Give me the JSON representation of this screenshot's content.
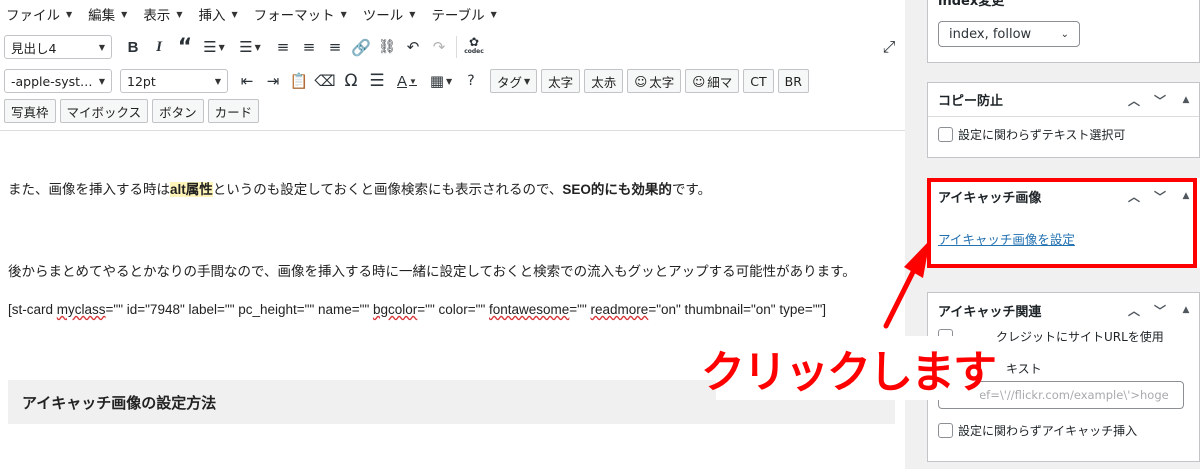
{
  "menubar": {
    "items": [
      "ファイル",
      "編集",
      "表示",
      "挿入",
      "フォーマット",
      "ツール",
      "テーブル"
    ]
  },
  "toolbar": {
    "format_select": "見出し4",
    "font_select": "-apple-syst…",
    "size_select": "12pt",
    "codec_label": "codec",
    "row2_buttons": [
      "タグ",
      "太字",
      "太赤",
      "太字",
      "細マ",
      "CT",
      "BR"
    ],
    "row3_buttons": [
      "写真枠",
      "マイボックス",
      "ボタン",
      "カード"
    ]
  },
  "content": {
    "p1_a": "また、画像を挿入する時は",
    "p1_b": "alt属性",
    "p1_c": "というのも設定しておくと画像検索にも表示されるので、",
    "p1_d": "SEO的にも効果的",
    "p1_e": "です。",
    "p2": "後からまとめてやるとかなりの手間なので、画像を挿入する時に一緒に設定しておくと検索での流入もグッとアップする可能性があります。",
    "sc_1": "[st-card ",
    "sc_2": "myclass",
    "sc_3": "=\"\" id=\"7948\" label=\"\" pc_height=\"\" name=\"\" ",
    "sc_4": "bgcolor",
    "sc_5": "=\"\" color=\"\" ",
    "sc_6": "fontawesome",
    "sc_7": "=\"\" ",
    "sc_8": "readmore",
    "sc_9": "=\"on\" thumbnail=\"on\" type=\"\"]",
    "heading": "アイキャッチ画像の設定方法"
  },
  "sidebar": {
    "index_title": "index変更",
    "index_select": "index, follow",
    "copy_title": "コピー防止",
    "copy_checkbox": "設定に関わらずテキスト選択可",
    "eyecatch_title": "アイキャッチ画像",
    "eyecatch_link": "アイキャッチ画像を設定",
    "related_title": "アイキャッチ関連",
    "related_checkbox1": "クレジットにサイトURLを使用",
    "related_text_label": "キスト",
    "related_input_placeholder": "<a href=\\'//flickr.com/example\\'>hoge",
    "related_checkbox2": "設定に関わらずアイキャッチ挿入"
  },
  "annotation": {
    "callout": "クリックします",
    "color": "#ff0000"
  }
}
